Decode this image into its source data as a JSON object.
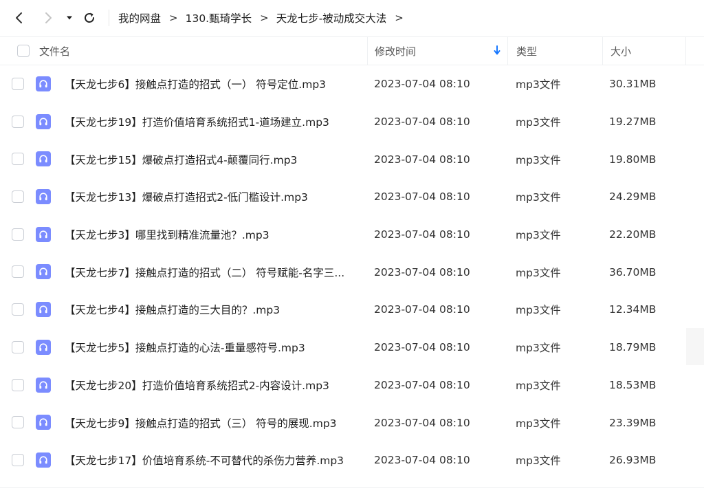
{
  "nav": {
    "back_icon": "chevron-left-icon",
    "forward_icon": "chevron-right-icon",
    "dropdown_icon": "caret-down-icon",
    "refresh_icon": "refresh-icon"
  },
  "breadcrumb": {
    "items": [
      "我的网盘",
      "130.甄琦学长",
      "天龙七步-被动成交大法"
    ],
    "separator": ">"
  },
  "table": {
    "headers": {
      "name": "文件名",
      "mtime": "修改时间",
      "type": "类型",
      "size": "大小"
    },
    "sort_indicator": "arrow-down-icon",
    "accent_color": "#1677ff",
    "file_icon_color": "#7b8cff",
    "rows": [
      {
        "name": "【天龙七步6】接触点打造的招式（一） 符号定位.mp3",
        "mtime": "2023-07-04 08:10",
        "type": "mp3文件",
        "size": "30.31MB"
      },
      {
        "name": "【天龙七步19】打造价值培育系统招式1-道场建立.mp3",
        "mtime": "2023-07-04 08:10",
        "type": "mp3文件",
        "size": "19.27MB"
      },
      {
        "name": "【天龙七步15】爆破点打造招式4-颠覆同行.mp3",
        "mtime": "2023-07-04 08:10",
        "type": "mp3文件",
        "size": "19.80MB"
      },
      {
        "name": "【天龙七步13】爆破点打造招式2-低门槛设计.mp3",
        "mtime": "2023-07-04 08:10",
        "type": "mp3文件",
        "size": "24.29MB"
      },
      {
        "name": "【天龙七步3】哪里找到精准流量池？.mp3",
        "mtime": "2023-07-04 08:10",
        "type": "mp3文件",
        "size": "22.20MB"
      },
      {
        "name": "【天龙七步7】接触点打造的招式（二） 符号赋能-名字三...",
        "mtime": "2023-07-04 08:10",
        "type": "mp3文件",
        "size": "36.70MB"
      },
      {
        "name": "【天龙七步4】接触点打造的三大目的？.mp3",
        "mtime": "2023-07-04 08:10",
        "type": "mp3文件",
        "size": "12.34MB"
      },
      {
        "name": "【天龙七步5】接触点打造的心法-重量感符号.mp3",
        "mtime": "2023-07-04 08:10",
        "type": "mp3文件",
        "size": "18.79MB"
      },
      {
        "name": "【天龙七步20】打造价值培育系统招式2-内容设计.mp3",
        "mtime": "2023-07-04 08:10",
        "type": "mp3文件",
        "size": "18.53MB"
      },
      {
        "name": "【天龙七步9】接触点打造的招式（三） 符号的展现.mp3",
        "mtime": "2023-07-04 08:10",
        "type": "mp3文件",
        "size": "23.39MB"
      },
      {
        "name": "【天龙七步17】价值培育系统-不可替代的杀伤力营养.mp3",
        "mtime": "2023-07-04 08:10",
        "type": "mp3文件",
        "size": "26.93MB"
      }
    ]
  }
}
